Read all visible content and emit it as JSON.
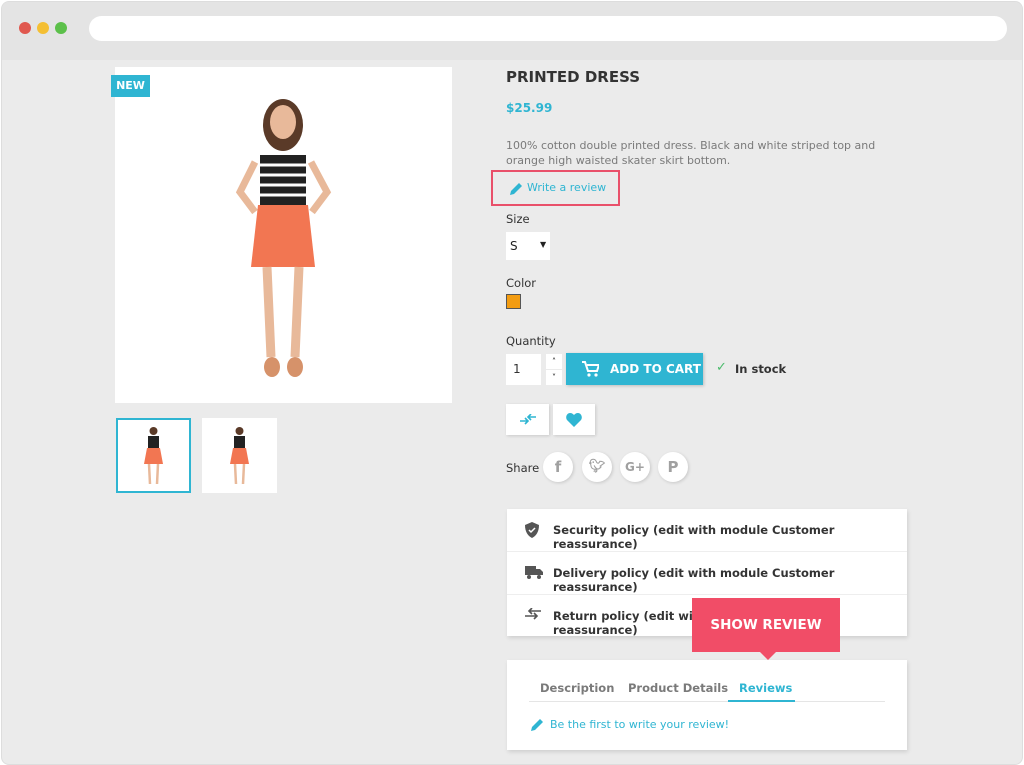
{
  "browser": {
    "dots": [
      "#e0584f",
      "#f4bf33",
      "#5cc04a"
    ]
  },
  "product": {
    "badge": "NEW",
    "title": "PRINTED DRESS",
    "price": "$25.99",
    "description": "100% cotton double printed dress. Black and white striped top and orange high waisted skater skirt bottom.",
    "write_review": "Write a review",
    "size_label": "Size",
    "size_value": "S",
    "color_label": "Color",
    "color_swatch": "#f39c11",
    "quantity_label": "Quantity",
    "quantity_value": "1",
    "add_to_cart": "ADD TO CART",
    "stock": "In stock",
    "share_label": "Share",
    "share_icons": [
      "facebook-icon",
      "twitter-icon",
      "google-plus-icon",
      "pinterest-icon"
    ]
  },
  "reassurance": [
    {
      "icon": "shield-icon",
      "text": "Security policy (edit with module Customer reassurance)"
    },
    {
      "icon": "truck-icon",
      "text": "Delivery policy (edit with module Customer reassurance)"
    },
    {
      "icon": "arrows-exchange-icon",
      "text": "Return policy (edit with module Customer reassurance)"
    }
  ],
  "tooltip": "SHOW REVIEW",
  "tabs": {
    "items": [
      "Description",
      "Product Details",
      "Reviews"
    ],
    "active": "Reviews",
    "review_link": "Be the first to write your review!"
  },
  "colors": {
    "accent": "#2fb5d2",
    "highlight": "#f14d67"
  }
}
